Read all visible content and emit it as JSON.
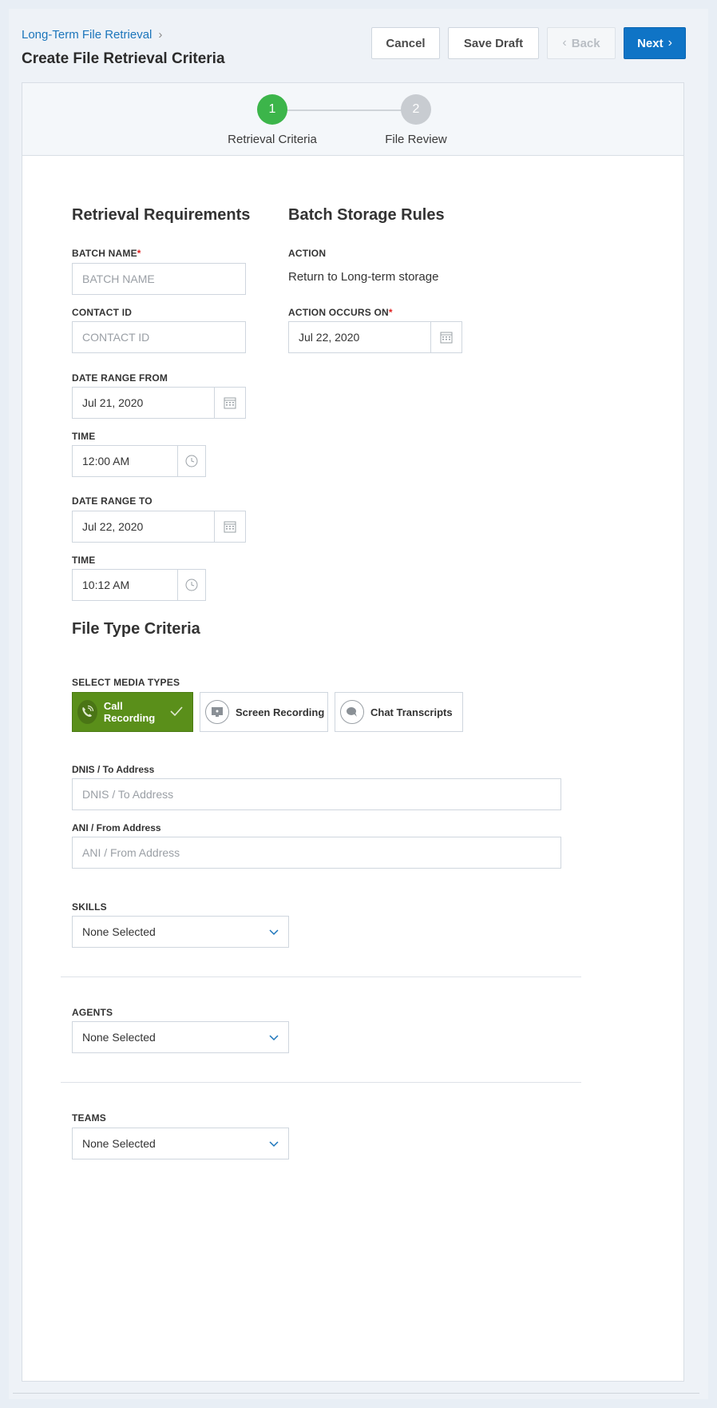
{
  "header": {
    "breadcrumb": "Long-Term File Retrieval",
    "title": "Create File Retrieval Criteria"
  },
  "toolbar": {
    "cancel_label": "Cancel",
    "save_label": "Save Draft",
    "back_label": "Back",
    "next_label": "Next"
  },
  "stepper": {
    "steps": [
      {
        "number": "1",
        "label": "Retrieval Criteria"
      },
      {
        "number": "2",
        "label": "File Review"
      }
    ]
  },
  "retrieval": {
    "title": "Retrieval Requirements",
    "batch_name_label": "BATCH NAME",
    "batch_name_placeholder": "BATCH NAME",
    "contact_id_label": "CONTACT ID",
    "contact_id_placeholder": "CONTACT ID",
    "date_from_label": "DATE RANGE FROM",
    "date_from_value": "Jul 21, 2020",
    "time_from_label": "TIME",
    "time_from_value": "12:00 AM",
    "date_to_label": "DATE RANGE TO",
    "date_to_value": "Jul 22, 2020",
    "time_to_label": "TIME",
    "time_to_value": "10:12 AM",
    "required_mark": "*"
  },
  "storage": {
    "title": "Batch Storage Rules",
    "action_label": "ACTION",
    "action_value": "Return to Long-term storage",
    "occurs_label": "ACTION OCCURS ON",
    "occurs_value": "Jul 22, 2020"
  },
  "file_type": {
    "title": "File Type Criteria",
    "media_label": "SELECT MEDIA TYPES",
    "media": [
      "Call Recording",
      "Screen Recording",
      "Chat Transcripts"
    ],
    "dnis_label": "DNIS / To Address",
    "dnis_placeholder": "DNIS / To Address",
    "ani_label": "ANI / From Address",
    "ani_placeholder": "ANI / From Address"
  },
  "filters": {
    "skills_label": "SKILLS",
    "skills_value": "None Selected",
    "agents_label": "AGENTS",
    "agents_value": "None Selected",
    "teams_label": "TEAMS",
    "teams_value": "None Selected"
  },
  "colors": {
    "primary": "#0f74c6",
    "step_active": "#3cb54a",
    "media_active": "#5a8f1a",
    "required": "#e02020"
  }
}
